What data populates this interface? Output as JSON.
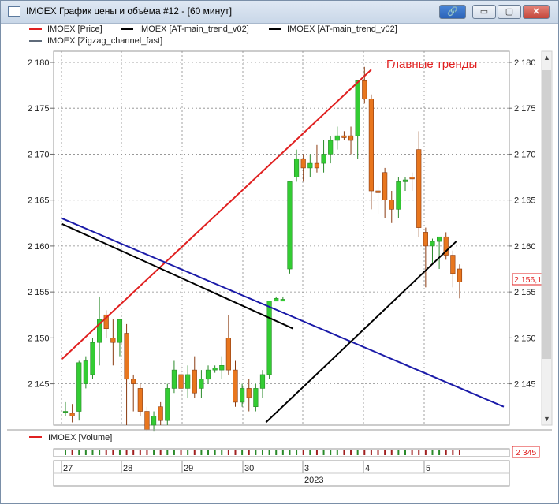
{
  "window": {
    "title": "IMOEX График цены и объёма #12 - [60 минут]",
    "buttons": {
      "link": "🔗",
      "minimize": "▭",
      "maximize": "▢",
      "close": "✕"
    }
  },
  "legend": [
    {
      "label": "IMOEX [Price]",
      "color": "#e02020"
    },
    {
      "label": "IMOEX [AT-main_trend_v02]",
      "color": "#000000"
    },
    {
      "label": "IMOEX [AT-main_trend_v02]",
      "color": "#000000"
    },
    {
      "label": "IMOEX [Zigzag_channel_fast]",
      "color": "#5f6b7a"
    }
  ],
  "annotation": "Главные тренды",
  "price_marker": "2 156,1",
  "volume_panel": {
    "label": "IMOEX [Volume]",
    "value_marker": "2 345"
  },
  "x_axis": {
    "day_labels": [
      "27",
      "28",
      "29",
      "30",
      "3",
      "4",
      "5"
    ],
    "year_label": "2023"
  },
  "colors": {
    "up": "#33cc33",
    "down": "#e8761e",
    "trend_red": "#e02020",
    "trend_black": "#000000",
    "trend_blue": "#1a1aa8",
    "grid": "#8a8a8a"
  },
  "chart_data": {
    "type": "candlestick",
    "y_ticks": [
      "2 145",
      "2 150",
      "2 155",
      "2 160",
      "2 165",
      "2 170",
      "2 175",
      "2 180"
    ],
    "y_tick_values": [
      2145,
      2150,
      2155,
      2160,
      2165,
      2170,
      2175,
      2180
    ],
    "ylim": [
      2140.5,
      2181.2
    ],
    "candles": [
      [
        2142.0,
        2143.0,
        2141.5,
        2142.0
      ],
      [
        2141.8,
        2142.8,
        2140.8,
        2141.5
      ],
      [
        2142.0,
        2147.5,
        2141.0,
        2147.3
      ],
      [
        2145.0,
        2148.0,
        2144.5,
        2147.5
      ],
      [
        2146.0,
        2150.0,
        2145.5,
        2149.5
      ],
      [
        2149.5,
        2154.5,
        2147.0,
        2152.0
      ],
      [
        2152.5,
        2153.0,
        2150.0,
        2151.0
      ],
      [
        2150.0,
        2152.0,
        2147.0,
        2149.5
      ],
      [
        2149.5,
        2152.0,
        2148.0,
        2152.0
      ],
      [
        2150.5,
        2151.5,
        2140.5,
        2145.5
      ],
      [
        2145.5,
        2146.0,
        2142.0,
        2145.0
      ],
      [
        2144.5,
        2145.0,
        2141.5,
        2142.0
      ],
      [
        2142.0,
        2142.5,
        2139.8,
        2140.0
      ],
      [
        2140.5,
        2142.0,
        2139.8,
        2141.5
      ],
      [
        2142.5,
        2143.0,
        2140.5,
        2141.0
      ],
      [
        2141.0,
        2145.0,
        2140.5,
        2144.5
      ],
      [
        2144.5,
        2147.5,
        2144.0,
        2146.5
      ],
      [
        2146.0,
        2147.0,
        2143.5,
        2144.5
      ],
      [
        2144.5,
        2147.0,
        2143.5,
        2146.0
      ],
      [
        2146.5,
        2148.0,
        2143.5,
        2144.0
      ],
      [
        2144.5,
        2146.5,
        2143.5,
        2145.5
      ],
      [
        2145.5,
        2147.0,
        2145.0,
        2146.5
      ],
      [
        2146.5,
        2147.0,
        2146.2,
        2146.7
      ],
      [
        2146.5,
        2148.0,
        2145.5,
        2147.0
      ],
      [
        2150.0,
        2152.5,
        2146.0,
        2146.5
      ],
      [
        2146.5,
        2147.5,
        2142.5,
        2143.0
      ],
      [
        2143.0,
        2145.0,
        2142.5,
        2144.5
      ],
      [
        2144.5,
        2145.5,
        2142.0,
        2143.5
      ],
      [
        2142.5,
        2145.0,
        2142.0,
        2144.5
      ],
      [
        2144.5,
        2146.5,
        2143.5,
        2146.0
      ],
      [
        2146.0,
        2154.0,
        2145.5,
        2154.0
      ],
      [
        2154.0,
        2154.5,
        2154.0,
        2154.3
      ],
      [
        2154.0,
        2154.5,
        2154.0,
        2154.2
      ],
      [
        2157.5,
        2167.0,
        2157.0,
        2167.0
      ],
      [
        2167.5,
        2170.5,
        2167.0,
        2169.5
      ],
      [
        2169.5,
        2170.0,
        2167.0,
        2168.5
      ],
      [
        2168.5,
        2170.0,
        2167.5,
        2169.0
      ],
      [
        2169.0,
        2171.0,
        2168.0,
        2168.5
      ],
      [
        2169.0,
        2171.5,
        2168.0,
        2170.0
      ],
      [
        2170.0,
        2172.0,
        2169.0,
        2171.5
      ],
      [
        2171.5,
        2173.0,
        2170.5,
        2172.0
      ],
      [
        2172.0,
        2172.5,
        2171.5,
        2171.8
      ],
      [
        2172.0,
        2173.0,
        2170.0,
        2171.5
      ],
      [
        2172.0,
        2178.0,
        2169.5,
        2178.0
      ],
      [
        2178.0,
        2179.5,
        2175.5,
        2176.0
      ],
      [
        2176.0,
        2176.5,
        2164.0,
        2166.0
      ],
      [
        2166.0,
        2166.5,
        2163.5,
        2165.8
      ],
      [
        2168.0,
        2168.5,
        2163.0,
        2165.0
      ],
      [
        2165.0,
        2166.0,
        2162.5,
        2164.0
      ],
      [
        2164.0,
        2167.5,
        2163.0,
        2167.0
      ],
      [
        2167.0,
        2167.5,
        2166.0,
        2167.2
      ],
      [
        2167.5,
        2168.0,
        2166.0,
        2167.3
      ],
      [
        2170.5,
        2172.5,
        2161.0,
        2162.0
      ],
      [
        2161.5,
        2162.0,
        2155.5,
        2160.0
      ],
      [
        2160.0,
        2160.8,
        2158.0,
        2160.5
      ],
      [
        2160.5,
        2161.0,
        2157.5,
        2161.0
      ],
      [
        2161.0,
        2161.5,
        2158.5,
        2159.0
      ],
      [
        2159.0,
        2159.5,
        2155.5,
        2157.0
      ],
      [
        2157.5,
        2158.0,
        2154.3,
        2156.1
      ]
    ],
    "trendlines": [
      {
        "color": "red",
        "from": [
          -0.5,
          2147.7
        ],
        "to": [
          45.0,
          2179.2
        ]
      },
      {
        "color": "blue",
        "from": [
          -0.5,
          2163.0
        ],
        "to": [
          64.5,
          2142.5
        ]
      },
      {
        "color": "black",
        "from": [
          -0.5,
          2162.4
        ],
        "to": [
          33.5,
          2151.0
        ]
      },
      {
        "color": "black",
        "from": [
          29.5,
          2140.8
        ],
        "to": [
          57.5,
          2160.5
        ]
      }
    ]
  }
}
